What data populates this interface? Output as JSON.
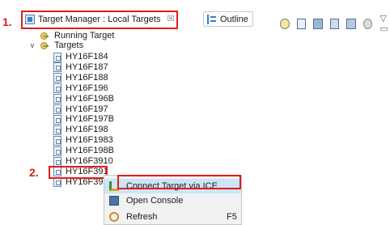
{
  "tabs": {
    "active": {
      "label": "Target Manager : Local Targets",
      "close": "☒"
    },
    "outline": {
      "label": "Outline"
    }
  },
  "toolbar": {
    "menu_glyphs": "▽ ▭"
  },
  "markers": [
    "1.",
    "2."
  ],
  "tree": {
    "running": "Running Target",
    "targets_root": "Targets",
    "targets": [
      "HY16F184",
      "HY16F187",
      "HY16F188",
      "HY16F196",
      "HY16F196B",
      "HY16F197",
      "HY16F197B",
      "HY16F198",
      "HY16F1983",
      "HY16F198B",
      "HY16F3910",
      "HY16F391",
      "HY16F398"
    ]
  },
  "context_menu": {
    "items": [
      {
        "label": "Connect Target via ICE",
        "accel": ""
      },
      {
        "label": "Open Console",
        "accel": ""
      },
      {
        "label": "Refresh",
        "accel": "F5"
      }
    ]
  },
  "colors": {
    "annotation_red": "#e01c1c",
    "menu_hover": "#cde6f7"
  }
}
